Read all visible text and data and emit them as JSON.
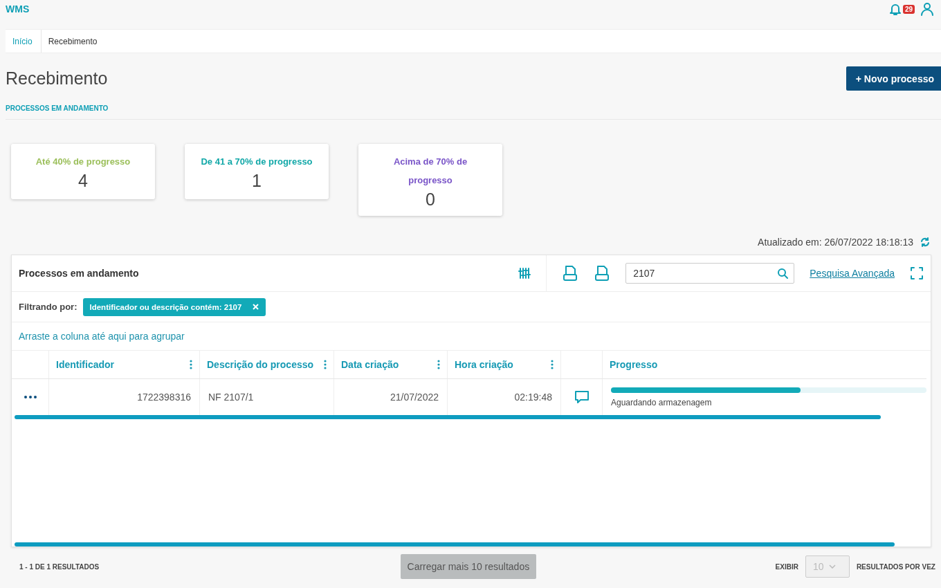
{
  "app": {
    "name": "WMS",
    "notification_count": "29"
  },
  "breadcrumb": [
    {
      "label": "Início",
      "link": true
    },
    {
      "label": "Recebimento",
      "link": false
    }
  ],
  "page": {
    "title": "Recebimento",
    "subtitle": "PROCESSOS EM ANDAMENTO",
    "new_button": "+ Novo processo"
  },
  "summary_cards": [
    {
      "label": "Até 40% de progresso",
      "count": "4",
      "color": "#9bbf5a"
    },
    {
      "label": "De 41 a 70% de progresso",
      "count": "1",
      "color": "#12a8a8"
    },
    {
      "label": "Acima de 70% de progresso",
      "count": "0",
      "color": "#7a55c8"
    }
  ],
  "updated": "Atualizado em: 26/07/2022 18:18:13",
  "grid": {
    "title": "Processos em andamento",
    "search": {
      "value": "2107"
    },
    "advanced_search": "Pesquisa Avançada",
    "filter_label": "Filtrando por:",
    "filters": [
      {
        "label": "Identificador ou descrição contém: 2107"
      }
    ],
    "group_hint": "Arraste a coluna até aqui para agrupar",
    "columns": [
      {
        "kind": "actions"
      },
      {
        "kind": "text",
        "label": "Identificador",
        "menu": true
      },
      {
        "kind": "text",
        "label": "Descrição do processo",
        "menu": true
      },
      {
        "kind": "text",
        "label": "Data criação",
        "menu": true
      },
      {
        "kind": "text",
        "label": "Hora criação",
        "menu": true
      },
      {
        "kind": "icon"
      },
      {
        "kind": "text",
        "label": "Progresso",
        "menu": false
      }
    ],
    "rows": [
      {
        "identifier": "1722398316",
        "description": "NF 2107/1",
        "date": "21/07/2022",
        "time": "02:19:48",
        "level": 0.6,
        "status": "Aguardando armazenagem"
      }
    ]
  },
  "footer": {
    "count": "1 - 1 DE 1 RESULTADOS",
    "load_more": {
      "label": "Carregar mais 10 resultados",
      "disabled": true
    },
    "show_label": "EXIBIR",
    "page_size": {
      "value": "10",
      "disabled": true
    },
    "per_page_label": "RESULTADOS POR VEZ"
  }
}
